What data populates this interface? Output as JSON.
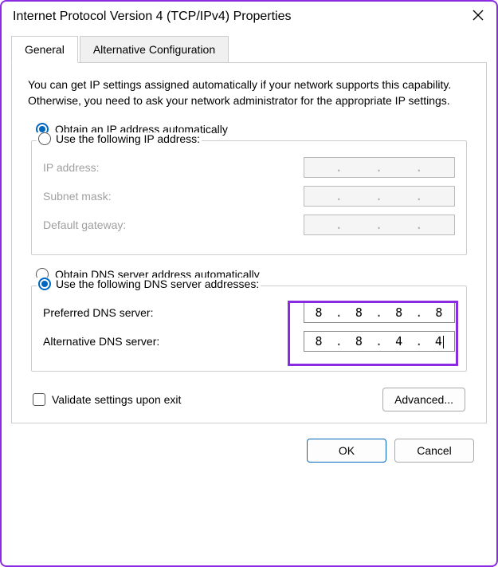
{
  "window": {
    "title": "Internet Protocol Version 4 (TCP/IPv4) Properties"
  },
  "tabs": {
    "general": "General",
    "alternative": "Alternative Configuration"
  },
  "intro": "You can get IP settings assigned automatically if your network supports this capability. Otherwise, you need to ask your network administrator for the appropriate IP settings.",
  "ip": {
    "obtain_auto": "Obtain an IP address automatically",
    "use_following": "Use the following IP address:",
    "address_label": "IP address:",
    "subnet_label": "Subnet mask:",
    "gateway_label": "Default gateway:",
    "address": [
      "",
      "",
      "",
      ""
    ],
    "subnet": [
      "",
      "",
      "",
      ""
    ],
    "gateway": [
      "",
      "",
      "",
      ""
    ]
  },
  "dns": {
    "obtain_auto": "Obtain DNS server address automatically",
    "use_following": "Use the following DNS server addresses:",
    "preferred_label": "Preferred DNS server:",
    "alternative_label": "Alternative DNS server:",
    "preferred": [
      "8",
      "8",
      "8",
      "8"
    ],
    "alternative": [
      "8",
      "8",
      "4",
      "4"
    ]
  },
  "validate": "Validate settings upon exit",
  "buttons": {
    "advanced": "Advanced...",
    "ok": "OK",
    "cancel": "Cancel"
  }
}
